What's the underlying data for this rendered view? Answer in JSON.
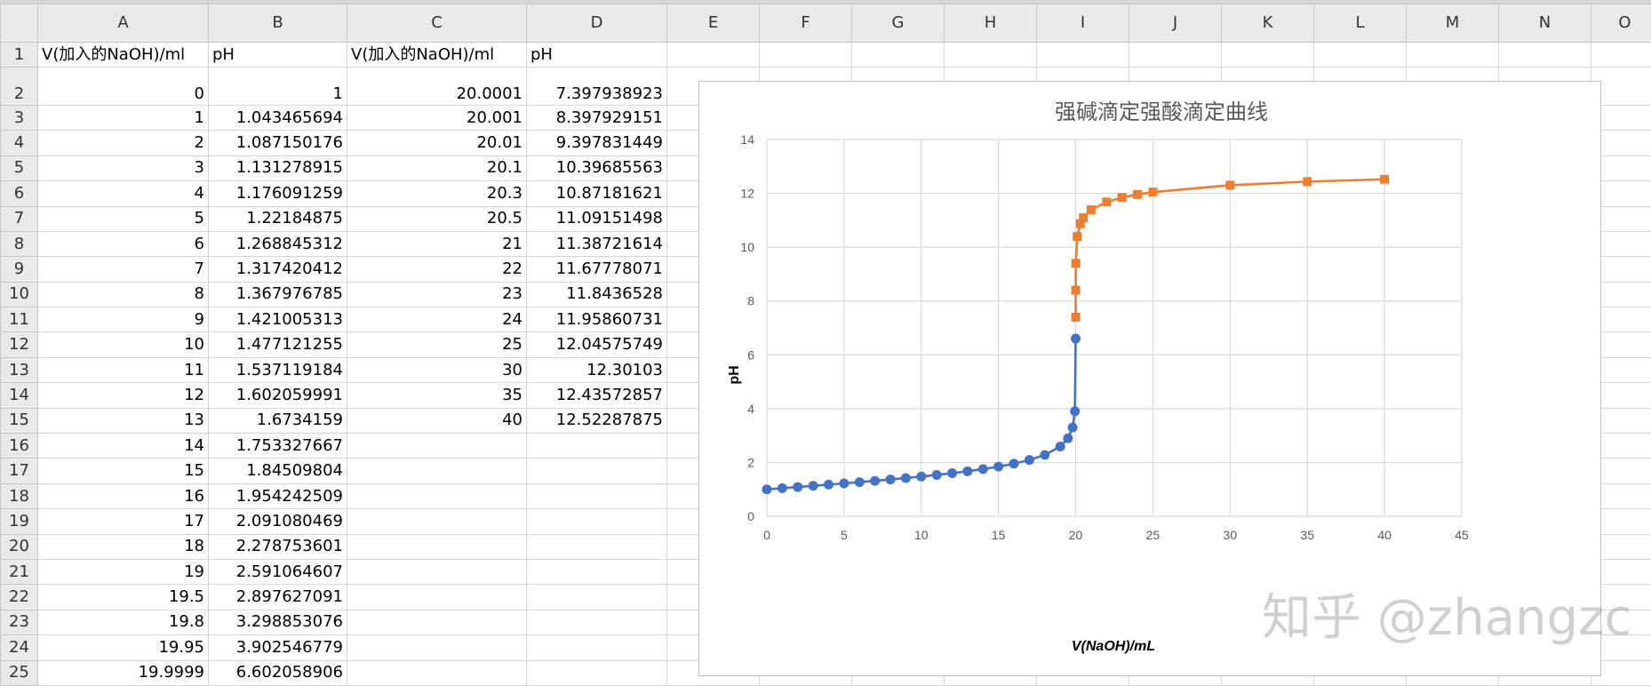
{
  "spreadsheet": {
    "column_headers": [
      "A",
      "B",
      "C",
      "D",
      "E",
      "F",
      "G",
      "H",
      "I",
      "J",
      "K",
      "L",
      "M",
      "N",
      "O"
    ],
    "header_row": [
      "V(加入的NaOH)/ml",
      "pH",
      "V(加入的NaOH)/ml",
      "pH"
    ],
    "rows": [
      [
        "0",
        "1",
        "20.0001",
        "7.397938923"
      ],
      [
        "1",
        "1.043465694",
        "20.001",
        "8.397929151"
      ],
      [
        "2",
        "1.087150176",
        "20.01",
        "9.397831449"
      ],
      [
        "3",
        "1.131278915",
        "20.1",
        "10.39685563"
      ],
      [
        "4",
        "1.176091259",
        "20.3",
        "10.87181621"
      ],
      [
        "5",
        "1.22184875",
        "20.5",
        "11.09151498"
      ],
      [
        "6",
        "1.268845312",
        "21",
        "11.38721614"
      ],
      [
        "7",
        "1.317420412",
        "22",
        "11.67778071"
      ],
      [
        "8",
        "1.367976785",
        "23",
        "11.8436528"
      ],
      [
        "9",
        "1.421005313",
        "24",
        "11.95860731"
      ],
      [
        "10",
        "1.477121255",
        "25",
        "12.04575749"
      ],
      [
        "11",
        "1.537119184",
        "30",
        "12.30103"
      ],
      [
        "12",
        "1.602059991",
        "35",
        "12.43572857"
      ],
      [
        "13",
        "1.6734159",
        "40",
        "12.52287875"
      ],
      [
        "14",
        "1.753327667",
        "",
        ""
      ],
      [
        "15",
        "1.84509804",
        "",
        ""
      ],
      [
        "16",
        "1.954242509",
        "",
        ""
      ],
      [
        "17",
        "2.091080469",
        "",
        ""
      ],
      [
        "18",
        "2.278753601",
        "",
        ""
      ],
      [
        "19",
        "2.591064607",
        "",
        ""
      ],
      [
        "19.5",
        "2.897627091",
        "",
        ""
      ],
      [
        "19.8",
        "3.298853076",
        "",
        ""
      ],
      [
        "19.95",
        "3.902546779",
        "",
        ""
      ],
      [
        "19.9999",
        "6.602058906",
        "",
        ""
      ]
    ]
  },
  "chart_data": {
    "type": "scatter",
    "title": "强碱滴定强酸滴定曲线",
    "xlabel": "V(NaOH)/mL",
    "ylabel": "pH",
    "xlim": [
      0,
      45
    ],
    "ylim": [
      0,
      14
    ],
    "xticks": [
      0,
      5,
      10,
      15,
      20,
      25,
      30,
      35,
      40,
      45
    ],
    "yticks": [
      0,
      2,
      4,
      6,
      8,
      10,
      12,
      14
    ],
    "grid": true,
    "series": [
      {
        "color": "#4472c4",
        "marker": "circle",
        "x": [
          0,
          1,
          2,
          3,
          4,
          5,
          6,
          7,
          8,
          9,
          10,
          11,
          12,
          13,
          14,
          15,
          16,
          17,
          18,
          19,
          19.5,
          19.8,
          19.95,
          19.9999
        ],
        "y": [
          1,
          1.043465694,
          1.087150176,
          1.131278915,
          1.176091259,
          1.22184875,
          1.268845312,
          1.317420412,
          1.367976785,
          1.421005313,
          1.477121255,
          1.537119184,
          1.602059991,
          1.6734159,
          1.753327667,
          1.84509804,
          1.954242509,
          2.091080469,
          2.278753601,
          2.591064607,
          2.897627091,
          3.298853076,
          3.902546779,
          6.602058906
        ]
      },
      {
        "color": "#ed7d31",
        "marker": "square",
        "x": [
          20.0001,
          20.001,
          20.01,
          20.1,
          20.3,
          20.5,
          21,
          22,
          23,
          24,
          25,
          30,
          35,
          40
        ],
        "y": [
          7.397938923,
          8.397929151,
          9.397831449,
          10.39685563,
          10.87181621,
          11.09151498,
          11.38721614,
          11.67778071,
          11.8436528,
          11.95860731,
          12.04575749,
          12.30103,
          12.43572857,
          12.52287875
        ]
      }
    ]
  },
  "watermark": "知乎 @zhangzc"
}
